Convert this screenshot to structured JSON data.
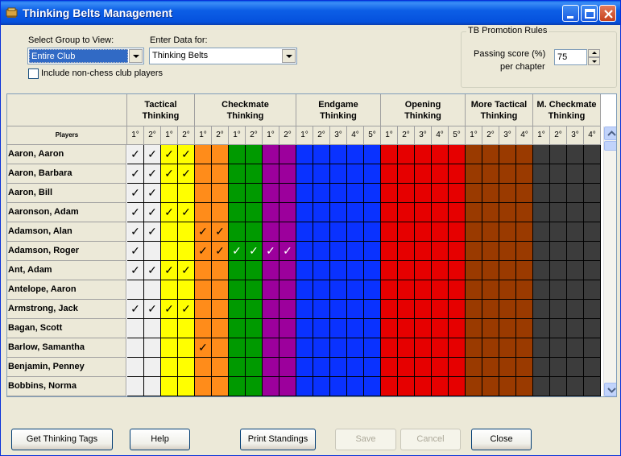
{
  "window": {
    "title": "Thinking Belts Management"
  },
  "controls": {
    "group_label": "Select Group to View:",
    "group_value": "Entire Club",
    "data_label": "Enter Data for:",
    "data_value": "Thinking Belts",
    "include_label": "Include non-chess club players",
    "include_checked": false
  },
  "promotion": {
    "title": "TB Promotion Rules",
    "label_line1": "Passing score (%)",
    "label_line2": "per chapter",
    "value": "75"
  },
  "grid": {
    "players_label": "Players",
    "check_mark": "✓",
    "groups": [
      {
        "line1": "Tactical",
        "line2": "Thinking",
        "columns": [
          {
            "label": "1°",
            "color": "#f0f0f0"
          },
          {
            "label": "2°",
            "color": "#f0f0f0"
          },
          {
            "label": "1°",
            "color": "#ffff00"
          },
          {
            "label": "2°",
            "color": "#ffff00"
          }
        ]
      },
      {
        "line1": "Checkmate",
        "line2": "Thinking",
        "columns": [
          {
            "label": "1°",
            "color": "#ff8c1a"
          },
          {
            "label": "2°",
            "color": "#ff8c1a"
          },
          {
            "label": "1°",
            "color": "#009a00"
          },
          {
            "label": "2°",
            "color": "#009a00"
          },
          {
            "label": "1°",
            "color": "#9c009c"
          },
          {
            "label": "2°",
            "color": "#9c009c"
          }
        ]
      },
      {
        "line1": "Endgame",
        "line2": "Thinking",
        "columns": [
          {
            "label": "1°",
            "color": "#0a32ff"
          },
          {
            "label": "2°",
            "color": "#0a32ff"
          },
          {
            "label": "3°",
            "color": "#0a32ff"
          },
          {
            "label": "4°",
            "color": "#0a32ff"
          },
          {
            "label": "5°",
            "color": "#0a32ff"
          }
        ]
      },
      {
        "line1": "Opening",
        "line2": "Thinking",
        "columns": [
          {
            "label": "1°",
            "color": "#e60000"
          },
          {
            "label": "2°",
            "color": "#e60000"
          },
          {
            "label": "3°",
            "color": "#e60000"
          },
          {
            "label": "4°",
            "color": "#e60000"
          },
          {
            "label": "5°",
            "color": "#e60000"
          }
        ]
      },
      {
        "line1": "More Tactical",
        "line2": "Thinking",
        "columns": [
          {
            "label": "1°",
            "color": "#9a3a00"
          },
          {
            "label": "2°",
            "color": "#9a3a00"
          },
          {
            "label": "3°",
            "color": "#9a3a00"
          },
          {
            "label": "4°",
            "color": "#9a3a00"
          }
        ]
      },
      {
        "line1": "M. Checkmate",
        "line2": "Thinking",
        "columns": [
          {
            "label": "1°",
            "color": "#3c3c3c"
          },
          {
            "label": "2°",
            "color": "#3c3c3c"
          },
          {
            "label": "3°",
            "color": "#3c3c3c"
          },
          {
            "label": "4°",
            "color": "#3c3c3c"
          }
        ]
      }
    ],
    "players": [
      {
        "name": "Aaron, Aaron",
        "checks": [
          0,
          1,
          2,
          3
        ]
      },
      {
        "name": "Aaron, Barbara",
        "checks": [
          0,
          1,
          2,
          3
        ]
      },
      {
        "name": "Aaron, Bill",
        "checks": [
          0,
          1
        ]
      },
      {
        "name": "Aaronson, Adam",
        "checks": [
          0,
          1,
          2,
          3
        ]
      },
      {
        "name": "Adamson, Alan",
        "checks": [
          0,
          1,
          4,
          5
        ]
      },
      {
        "name": "Adamson, Roger",
        "checks": [
          0,
          4,
          5,
          6,
          7,
          8,
          9
        ]
      },
      {
        "name": "Ant, Adam",
        "checks": [
          0,
          1,
          2,
          3
        ]
      },
      {
        "name": "Antelope, Aaron",
        "checks": []
      },
      {
        "name": "Armstrong, Jack",
        "checks": [
          0,
          1,
          2,
          3
        ]
      },
      {
        "name": "Bagan, Scott",
        "checks": []
      },
      {
        "name": "Barlow, Samantha",
        "checks": [
          4
        ]
      },
      {
        "name": "Benjamin, Penney",
        "checks": []
      },
      {
        "name": "Bobbins, Norma",
        "checks": []
      }
    ]
  },
  "buttons": {
    "get_tags": "Get Thinking Tags",
    "help": "Help",
    "print": "Print Standings",
    "save": "Save",
    "cancel": "Cancel",
    "close": "Close"
  }
}
